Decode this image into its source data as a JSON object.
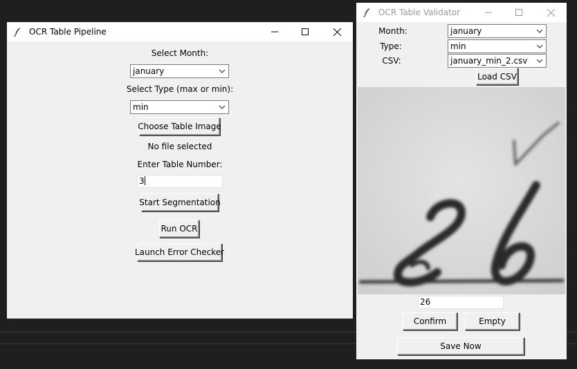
{
  "pipeline": {
    "title": "OCR Table Pipeline",
    "select_month_label": "Select Month:",
    "month_value": "january",
    "select_type_label": "Select Type (max or min):",
    "type_value": "min",
    "choose_image_button": "Choose Table Image",
    "file_status": "No file selected",
    "table_number_label": "Enter Table Number:",
    "table_number_value": "3",
    "start_segmentation_button": "Start Segmentation",
    "run_ocr_button": "Run OCR",
    "launch_error_checker_button": "Launch Error Checker"
  },
  "validator": {
    "title": "OCR Table Validator",
    "month_label": "Month:",
    "month_value": "january",
    "type_label": "Type:",
    "type_value": "min",
    "csv_label": "CSV:",
    "csv_value": "january_min_2.csv",
    "load_csv_button": "Load CSV",
    "cell_value": "26",
    "confirm_button": "Confirm",
    "empty_button": "Empty",
    "save_now_button": "Save Now"
  },
  "colors": {
    "window_bg": "#f0f0f0",
    "titlebar_active": "#ffffff",
    "titlebar_inactive_text": "#999999",
    "desktop": "#1f1f1f"
  }
}
